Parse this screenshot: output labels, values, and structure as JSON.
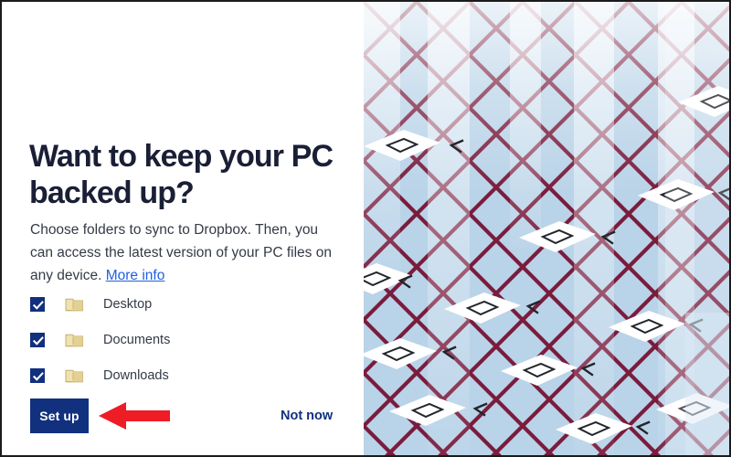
{
  "dialog": {
    "headline": "Want to keep your PC backed up?",
    "body_text_before_link": "Choose folders to sync to Dropbox. Then, you can access the latest version of your PC files on any device. ",
    "more_info_label": "More info",
    "folders": [
      {
        "label": "Desktop",
        "checked": true,
        "icon": "folder-icon"
      },
      {
        "label": "Documents",
        "checked": true,
        "icon": "folder-icon"
      },
      {
        "label": "Downloads",
        "checked": true,
        "icon": "folder-icon"
      }
    ],
    "primary_button_label": "Set up",
    "secondary_link_label": "Not now"
  },
  "annotation": {
    "arrow_icon": "left-arrow-icon",
    "arrow_color": "#ee1c25",
    "points_to": "Set up"
  },
  "artwork": {
    "description": "isometric lattice illustration",
    "background_color": "#b9d3e8",
    "lattice_color": "#7a1c3d",
    "card_color": "#ffffff",
    "glyph_color": "#22252b"
  },
  "colors": {
    "brand_blue": "#11307e",
    "link_blue": "#1f5fe0",
    "heading": "#1a1f36",
    "body": "#343a46",
    "accent_red": "#ee1c25",
    "folder_yellow": "#e8d18a"
  }
}
